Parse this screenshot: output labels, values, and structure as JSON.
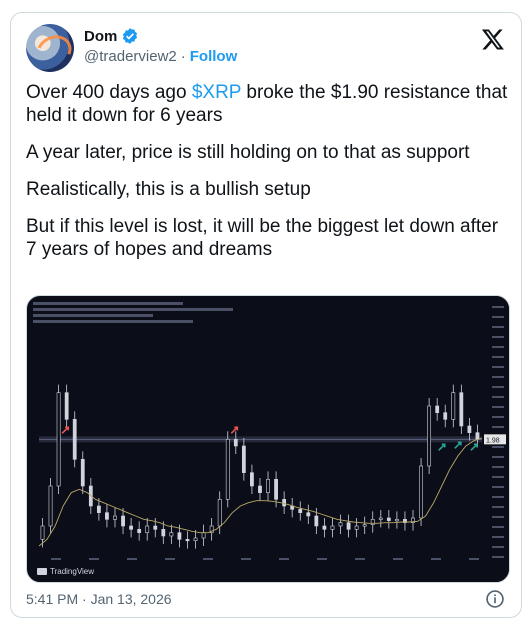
{
  "author": {
    "display_name": "Dom",
    "handle": "@traderview2",
    "separator": "·",
    "follow_label": "Follow"
  },
  "tweet": {
    "p1_before": "Over 400 days ago ",
    "cashtag": "$XRP",
    "p1_after": " broke the $1.90 resistance that held it down for 6 years",
    "p2": "A year later, price is still holding on to that as support",
    "p3": "Realistically, this is a bullish setup",
    "p4": "But if this level is lost, it will be the biggest let down after 7 years of hopes and dreams"
  },
  "media": {
    "tv_label": "TradingView",
    "price_tag": "1.98"
  },
  "chart_data": {
    "type": "line",
    "resistance_level": 1.9,
    "series": [
      {
        "values": [
          0.4,
          0.6,
          1.2,
          2.6,
          2.2,
          1.6,
          1.2,
          0.9,
          0.8,
          0.7,
          0.75,
          0.6,
          0.55,
          0.5,
          0.6,
          0.55,
          0.45,
          0.5,
          0.4,
          0.38,
          0.42,
          0.5,
          0.6,
          1.0,
          1.9,
          1.8,
          1.4,
          1.2,
          1.1,
          1.3,
          1.0,
          0.9,
          0.85,
          0.8,
          0.75,
          0.6,
          0.55,
          0.6,
          0.65,
          0.55,
          0.6,
          0.62,
          0.7,
          0.72,
          0.68,
          0.7,
          0.65,
          0.72,
          1.5,
          2.4,
          2.3,
          2.2,
          2.6,
          2.1,
          2.0,
          1.9
        ]
      },
      {
        "values": [
          0.3,
          0.4,
          0.6,
          0.9,
          1.1,
          1.15,
          1.1,
          1.0,
          0.95,
          0.9,
          0.85,
          0.8,
          0.75,
          0.7,
          0.68,
          0.65,
          0.6,
          0.58,
          0.55,
          0.52,
          0.5,
          0.5,
          0.55,
          0.65,
          0.8,
          0.9,
          0.95,
          0.98,
          0.98,
          0.97,
          0.95,
          0.92,
          0.88,
          0.85,
          0.82,
          0.78,
          0.74,
          0.7,
          0.68,
          0.66,
          0.65,
          0.64,
          0.64,
          0.65,
          0.65,
          0.66,
          0.66,
          0.67,
          0.75,
          0.95,
          1.2,
          1.45,
          1.65,
          1.8,
          1.88,
          1.92
        ]
      }
    ],
    "ylim": [
      0,
      3
    ],
    "colors": {
      "up": "#26a69a",
      "down": "#ef5350",
      "candle": "#d1d4dc",
      "ma": "#b9a86a",
      "level": "#5d6180"
    }
  },
  "footer": {
    "timestamp": "5:41 PM · Jan 13, 2026"
  }
}
